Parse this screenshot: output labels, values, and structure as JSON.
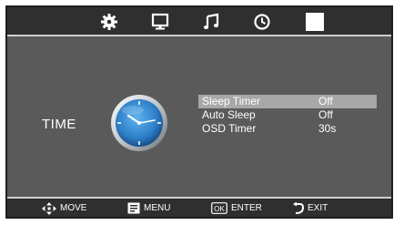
{
  "tabs": [
    {
      "icon": "gear-icon",
      "label": ""
    },
    {
      "icon": "monitor-icon",
      "label": ""
    },
    {
      "icon": "music-note-icon",
      "label": ""
    },
    {
      "icon": "clock-icon",
      "label": ""
    },
    {
      "icon": "blank-selected-icon",
      "label": "",
      "selected": true
    }
  ],
  "section": {
    "title": "TIME",
    "icon": "clock-icon"
  },
  "menu": {
    "items": [
      {
        "label": "Sleep Timer",
        "value": "Off",
        "highlighted": true
      },
      {
        "label": "Auto Sleep",
        "value": "Off"
      },
      {
        "label": "OSD Timer",
        "value": "30s"
      }
    ]
  },
  "footer": {
    "move_label": "MOVE",
    "menu_label": "MENU",
    "enter_label": "ENTER",
    "exit_label": "EXIT",
    "ok_label": "OK"
  },
  "colors": {
    "background": "#5a5a5a",
    "bar": "#2f2f2f",
    "highlight": "#a8a8a8",
    "clock_face": "#2d7fc7"
  }
}
